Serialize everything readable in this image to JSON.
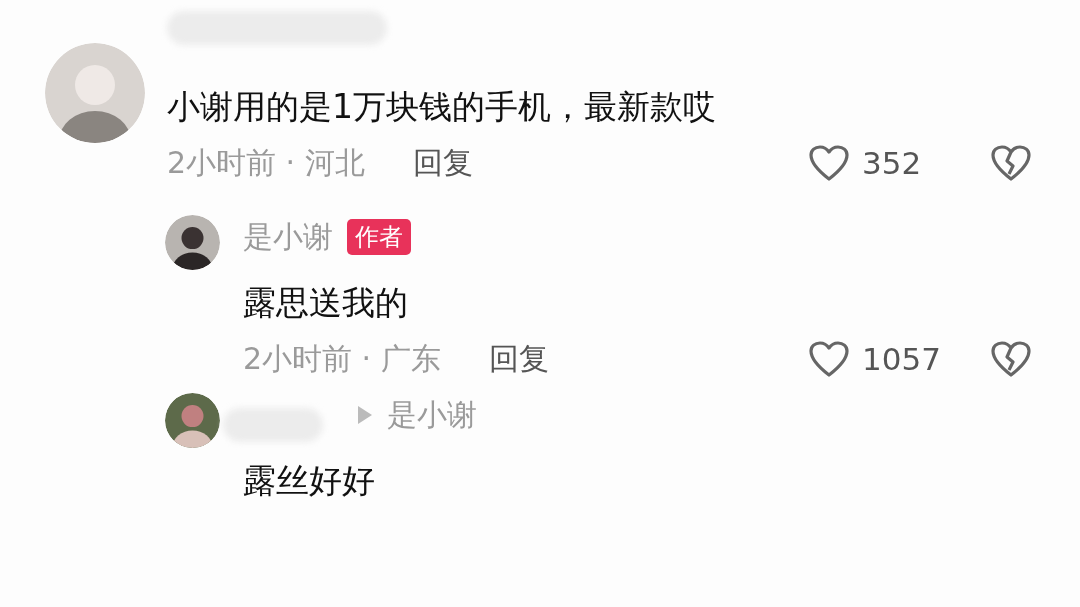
{
  "comments": [
    {
      "text": "小谢用的是1万块钱的手机，最新款哎",
      "time_location": "2小时前 · 河北",
      "reply_label": "回复",
      "likes": "352",
      "replies": [
        {
          "author": "是小谢",
          "badge": "作者",
          "text": "露思送我的",
          "time_location": "2小时前 · 广东",
          "reply_label": "回复",
          "likes": "1057"
        },
        {
          "reply_to": "是小谢",
          "text": "露丝好好"
        }
      ]
    }
  ]
}
